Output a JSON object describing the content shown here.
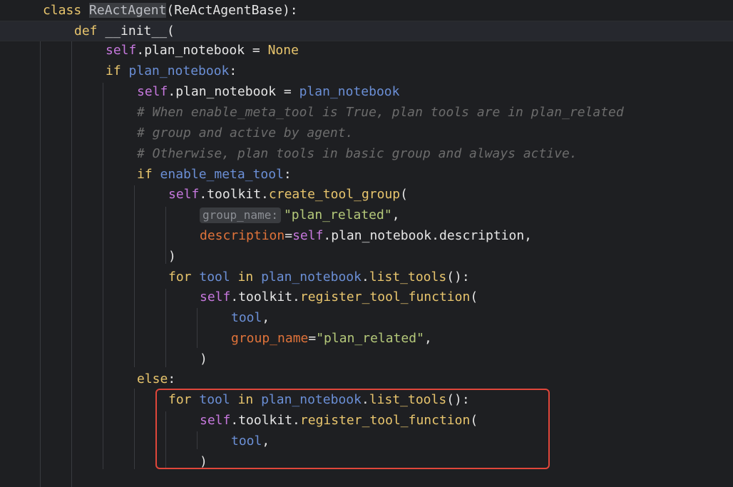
{
  "code_lines": [
    {
      "tokens": [
        [
          "kw",
          "class "
        ],
        [
          "cls",
          "ReActAgent"
        ],
        [
          "p",
          "(ReActAgentBase):"
        ]
      ]
    },
    {
      "tokens": [
        [
          "kw",
          "def "
        ],
        [
          "p",
          "__init__("
        ]
      ]
    },
    {
      "tokens": [
        [
          "self",
          "self"
        ],
        [
          "p",
          ".plan_notebook = "
        ],
        [
          "kw",
          "None"
        ]
      ]
    },
    {
      "tokens": [
        [
          "kw",
          "if "
        ],
        [
          "var",
          "plan_notebook"
        ],
        [
          "p",
          ":"
        ]
      ]
    },
    {
      "tokens": [
        [
          "self",
          "self"
        ],
        [
          "p",
          ".plan_notebook = "
        ],
        [
          "var",
          "plan_notebook"
        ]
      ]
    },
    {
      "tokens": [
        [
          "cm",
          "# When enable_meta_tool is True, plan tools are in plan_related"
        ]
      ]
    },
    {
      "tokens": [
        [
          "cm",
          "# group and active by agent."
        ]
      ]
    },
    {
      "tokens": [
        [
          "cm",
          "# Otherwise, plan tools in basic group and always active."
        ]
      ]
    },
    {
      "tokens": [
        [
          "kw",
          "if "
        ],
        [
          "var",
          "enable_meta_tool"
        ],
        [
          "p",
          ":"
        ]
      ]
    },
    {
      "tokens": [
        [
          "self",
          "self"
        ],
        [
          "p",
          ".toolkit."
        ],
        [
          "fn",
          "create_tool_group"
        ],
        [
          "p",
          "("
        ]
      ]
    },
    {
      "tokens": [
        [
          "hint",
          "group_name:"
        ],
        [
          "str",
          "\"plan_related\""
        ],
        [
          "p",
          ","
        ]
      ]
    },
    {
      "tokens": [
        [
          "named",
          "description"
        ],
        [
          "p",
          "="
        ],
        [
          "self",
          "self"
        ],
        [
          "p",
          ".plan_notebook.description,"
        ]
      ]
    },
    {
      "tokens": [
        [
          "p",
          ")"
        ]
      ]
    },
    {
      "tokens": [
        [
          "kw",
          "for "
        ],
        [
          "var",
          "tool"
        ],
        [
          "kw",
          " in "
        ],
        [
          "var",
          "plan_notebook"
        ],
        [
          "p",
          "."
        ],
        [
          "fn",
          "list_tools"
        ],
        [
          "p",
          "():"
        ]
      ]
    },
    {
      "tokens": [
        [
          "self",
          "self"
        ],
        [
          "p",
          ".toolkit."
        ],
        [
          "fn",
          "register_tool_function"
        ],
        [
          "p",
          "("
        ]
      ]
    },
    {
      "tokens": [
        [
          "var",
          "tool"
        ],
        [
          "p",
          ","
        ]
      ]
    },
    {
      "tokens": [
        [
          "named",
          "group_name"
        ],
        [
          "p",
          "="
        ],
        [
          "str",
          "\"plan_related\""
        ],
        [
          "p",
          ","
        ]
      ]
    },
    {
      "tokens": [
        [
          "p",
          ")"
        ]
      ]
    },
    {
      "tokens": [
        [
          "kw",
          "else"
        ],
        [
          "p",
          ":"
        ]
      ]
    },
    {
      "tokens": [
        [
          "kw",
          "for "
        ],
        [
          "var",
          "tool"
        ],
        [
          "kw",
          " in "
        ],
        [
          "var",
          "plan_notebook"
        ],
        [
          "p",
          "."
        ],
        [
          "fn",
          "list_tools"
        ],
        [
          "p",
          "():"
        ]
      ]
    },
    {
      "tokens": [
        [
          "self",
          "self"
        ],
        [
          "p",
          ".toolkit."
        ],
        [
          "fn",
          "register_tool_function"
        ],
        [
          "p",
          "("
        ]
      ]
    },
    {
      "tokens": [
        [
          "var",
          "tool"
        ],
        [
          "p",
          ","
        ]
      ]
    },
    {
      "tokens": [
        [
          "p",
          ")"
        ]
      ]
    }
  ],
  "colors": {
    "background": "#1e1f22",
    "keyword": "#e8c56d",
    "self": "#c678dd",
    "function": "#e8c56d",
    "variable": "#6b8fd6",
    "string": "#b5c97a",
    "named_arg": "#e0733a",
    "comment": "#6c6c6c",
    "highlight_box": "#e0463a"
  }
}
